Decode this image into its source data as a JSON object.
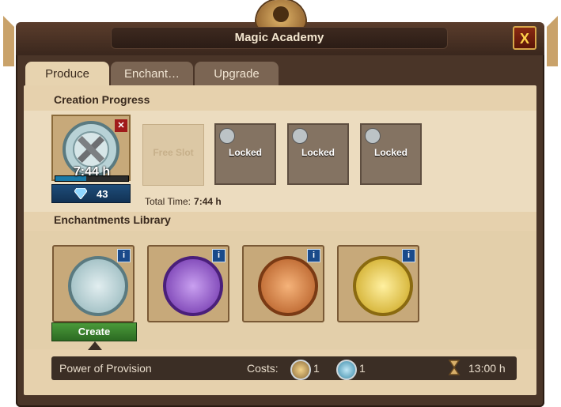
{
  "window": {
    "title": "Magic Academy",
    "close_label": "X"
  },
  "tabs": [
    {
      "label": "Produce",
      "active": true
    },
    {
      "label": "Enchant…",
      "active": false
    },
    {
      "label": "Upgrade",
      "active": false
    }
  ],
  "creation_progress": {
    "heading": "Creation Progress",
    "current": {
      "icon": "crossed-hammers-medal-icon",
      "time_left": "7:44 h",
      "progress": 0.42,
      "gem_cost": "43"
    },
    "slots": [
      {
        "label": "Free Slot",
        "state": "free"
      },
      {
        "label": "Locked",
        "state": "locked"
      },
      {
        "label": "Locked",
        "state": "locked"
      },
      {
        "label": "Locked",
        "state": "locked"
      }
    ],
    "total_time_label": "Total Time:",
    "total_time_value": "7:44 h"
  },
  "library": {
    "heading": "Enchantments Library",
    "items": [
      {
        "name": "crossed-hammers",
        "color": "#9fc4c8"
      },
      {
        "name": "handshake",
        "color": "#8a4ec4"
      },
      {
        "name": "crate",
        "color": "#d47a3a"
      },
      {
        "name": "golden-book",
        "color": "#e2c23a"
      }
    ],
    "create_label": "Create"
  },
  "info_bar": {
    "name": "Power of Provision",
    "costs_label": "Costs:",
    "cost_1_value": "1",
    "cost_2_value": "1",
    "time": "13:00 h"
  }
}
